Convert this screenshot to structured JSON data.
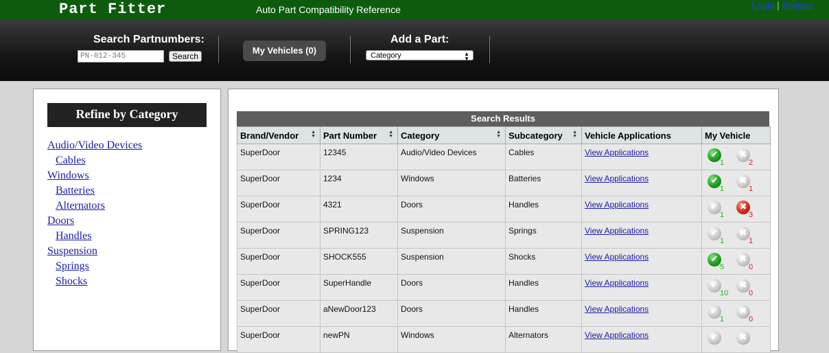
{
  "header": {
    "brand": "Part Fitter",
    "tagline": "Auto Part Compatibility Reference",
    "login": "Login",
    "separator": "|",
    "register": "Register"
  },
  "search": {
    "label": "Search Partnumbers:",
    "placeholder": "PN-012-345",
    "button": "Search",
    "my_vehicles": "My Vehicles (0)",
    "add_part_label": "Add a Part:",
    "category_selected": "Category"
  },
  "sidebar": {
    "title": "Refine by Category",
    "items": [
      {
        "label": "Audio/Video Devices",
        "level": 0
      },
      {
        "label": "Cables",
        "level": 1
      },
      {
        "label": "Windows",
        "level": 0
      },
      {
        "label": "Batteries",
        "level": 1
      },
      {
        "label": "Alternators",
        "level": 1
      },
      {
        "label": "Doors",
        "level": 0
      },
      {
        "label": "Handles",
        "level": 1
      },
      {
        "label": "Suspension",
        "level": 0
      },
      {
        "label": "Springs",
        "level": 1
      },
      {
        "label": "Shocks",
        "level": 1
      }
    ]
  },
  "results": {
    "title": "Search Results",
    "columns": [
      "Brand/Vendor",
      "Part Number",
      "Category",
      "Subcategory",
      "Vehicle Applications",
      "My Vehicle"
    ],
    "rows": [
      {
        "brand": "SuperDoor",
        "part": "12345",
        "category": "Audio/Video Devices",
        "subcategory": "Cables",
        "link": "View Applications",
        "fits": "1",
        "fits_active": true,
        "nofit": "2",
        "nofit_active": false
      },
      {
        "brand": "SuperDoor",
        "part": "1234",
        "category": "Windows",
        "subcategory": "Batteries",
        "link": "View Applications",
        "fits": "1",
        "fits_active": true,
        "nofit": "1",
        "nofit_active": false
      },
      {
        "brand": "SuperDoor",
        "part": "4321",
        "category": "Doors",
        "subcategory": "Handles",
        "link": "View Applications",
        "fits": "1",
        "fits_active": false,
        "nofit": "3",
        "nofit_active": true
      },
      {
        "brand": "SuperDoor",
        "part": "SPRING123",
        "category": "Suspension",
        "subcategory": "Springs",
        "link": "View Applications",
        "fits": "1",
        "fits_active": false,
        "nofit": "1",
        "nofit_active": false
      },
      {
        "brand": "SuperDoor",
        "part": "SHOCK555",
        "category": "Suspension",
        "subcategory": "Shocks",
        "link": "View Applications",
        "fits": "5",
        "fits_active": true,
        "nofit": "0",
        "nofit_active": false
      },
      {
        "brand": "SuperDoor",
        "part": "SuperHandle",
        "category": "Doors",
        "subcategory": "Handles",
        "link": "View Applications",
        "fits": "10",
        "fits_active": false,
        "nofit": "0",
        "nofit_active": false
      },
      {
        "brand": "SuperDoor",
        "part": "aNewDoor123",
        "category": "Doors",
        "subcategory": "Handles",
        "link": "View Applications",
        "fits": "1",
        "fits_active": false,
        "nofit": "0",
        "nofit_active": false
      },
      {
        "brand": "SuperDoor",
        "part": "newPN",
        "category": "Windows",
        "subcategory": "Alternators",
        "link": "View Applications",
        "fits": "",
        "fits_active": false,
        "nofit": "",
        "nofit_active": false
      }
    ]
  }
}
